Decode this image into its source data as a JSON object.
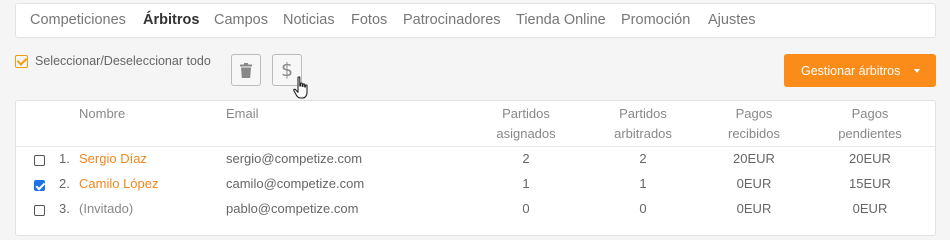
{
  "tabs": [
    "Competiciones",
    "Árbitros",
    "Campos",
    "Noticias",
    "Fotos",
    "Patrocinadores",
    "Tienda Online",
    "Promoción",
    "Ajustes"
  ],
  "active_tab": "Árbitros",
  "toolbar": {
    "select_all_label": "Seleccionar/Deseleccionar todo",
    "delete_icon": "trash-icon",
    "payment_icon": "dollar-icon",
    "manage_label": "Gestionar árbitros"
  },
  "table": {
    "headers": {
      "name": "Nombre",
      "email": "Email",
      "assigned": [
        "Partidos",
        "asignados"
      ],
      "refereed": [
        "Partidos",
        "arbitrados"
      ],
      "received": [
        "Pagos",
        "recibidos"
      ],
      "pending": [
        "Pagos",
        "pendientes"
      ]
    },
    "rows": [
      {
        "checked": false,
        "index": "1.",
        "name": "Sergio Díaz",
        "email": "sergio@competize.com",
        "assigned": "2",
        "refereed": "2",
        "received": "20EUR",
        "pending": "20EUR"
      },
      {
        "checked": true,
        "index": "2.",
        "name": "Camilo López",
        "email": "camilo@competize.com",
        "assigned": "1",
        "refereed": "1",
        "received": "0EUR",
        "pending": "15EUR"
      },
      {
        "checked": false,
        "index": "3.",
        "name": "(Invitado)",
        "email": "pablo@competize.com",
        "assigned": "0",
        "refereed": "0",
        "received": "0EUR",
        "pending": "0EUR"
      }
    ]
  },
  "colors": {
    "accent": "#fb8c1a",
    "checkbox_checked": "#1a73e8"
  }
}
